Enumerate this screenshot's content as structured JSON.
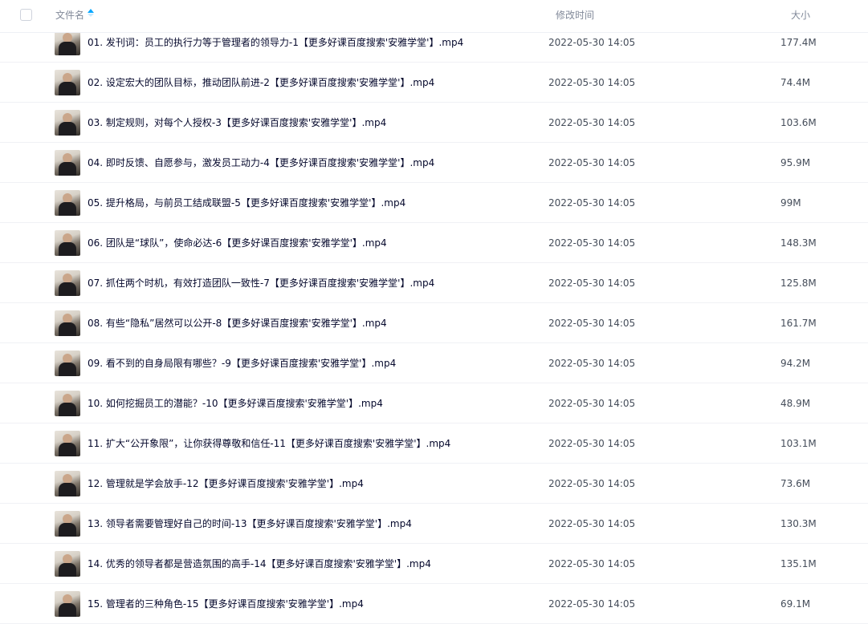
{
  "header": {
    "name_label": "文件名",
    "time_label": "修改时间",
    "size_label": "大小"
  },
  "files": [
    {
      "name": "01. 发刊词：员工的执行力等于管理者的领导力-1【更多好课百度搜索'安雅学堂'】.mp4",
      "time": "2022-05-30 14:05",
      "size": "177.4M"
    },
    {
      "name": "02. 设定宏大的团队目标，推动团队前进-2【更多好课百度搜索'安雅学堂'】.mp4",
      "time": "2022-05-30 14:05",
      "size": "74.4M"
    },
    {
      "name": "03. 制定规则，对每个人授权-3【更多好课百度搜索'安雅学堂'】.mp4",
      "time": "2022-05-30 14:05",
      "size": "103.6M"
    },
    {
      "name": "04. 即时反馈、自愿参与，激发员工动力-4【更多好课百度搜索'安雅学堂'】.mp4",
      "time": "2022-05-30 14:05",
      "size": "95.9M"
    },
    {
      "name": "05. 提升格局，与前员工结成联盟-5【更多好课百度搜索'安雅学堂'】.mp4",
      "time": "2022-05-30 14:05",
      "size": "99M"
    },
    {
      "name": "06. 团队是“球队”，使命必达-6【更多好课百度搜索'安雅学堂'】.mp4",
      "time": "2022-05-30 14:05",
      "size": "148.3M"
    },
    {
      "name": "07. 抓住两个时机，有效打造团队一致性-7【更多好课百度搜索'安雅学堂'】.mp4",
      "time": "2022-05-30 14:05",
      "size": "125.8M"
    },
    {
      "name": "08. 有些“隐私”居然可以公开-8【更多好课百度搜索'安雅学堂'】.mp4",
      "time": "2022-05-30 14:05",
      "size": "161.7M"
    },
    {
      "name": "09. 看不到的自身局限有哪些？-9【更多好课百度搜索'安雅学堂'】.mp4",
      "time": "2022-05-30 14:05",
      "size": "94.2M"
    },
    {
      "name": "10. 如何挖掘员工的潜能？-10【更多好课百度搜索'安雅学堂'】.mp4",
      "time": "2022-05-30 14:05",
      "size": "48.9M"
    },
    {
      "name": "11. 扩大“公开象限”，让你获得尊敬和信任-11【更多好课百度搜索'安雅学堂'】.mp4",
      "time": "2022-05-30 14:05",
      "size": "103.1M"
    },
    {
      "name": "12. 管理就是学会放手-12【更多好课百度搜索'安雅学堂'】.mp4",
      "time": "2022-05-30 14:05",
      "size": "73.6M"
    },
    {
      "name": "13. 领导者需要管理好自己的时间-13【更多好课百度搜索'安雅学堂'】.mp4",
      "time": "2022-05-30 14:05",
      "size": "130.3M"
    },
    {
      "name": "14. 优秀的领导者都是营造氛围的高手-14【更多好课百度搜索'安雅学堂'】.mp4",
      "time": "2022-05-30 14:05",
      "size": "135.1M"
    },
    {
      "name": "15. 管理者的三种角色-15【更多好课百度搜索'安雅学堂'】.mp4",
      "time": "2022-05-30 14:05",
      "size": "69.1M"
    }
  ]
}
